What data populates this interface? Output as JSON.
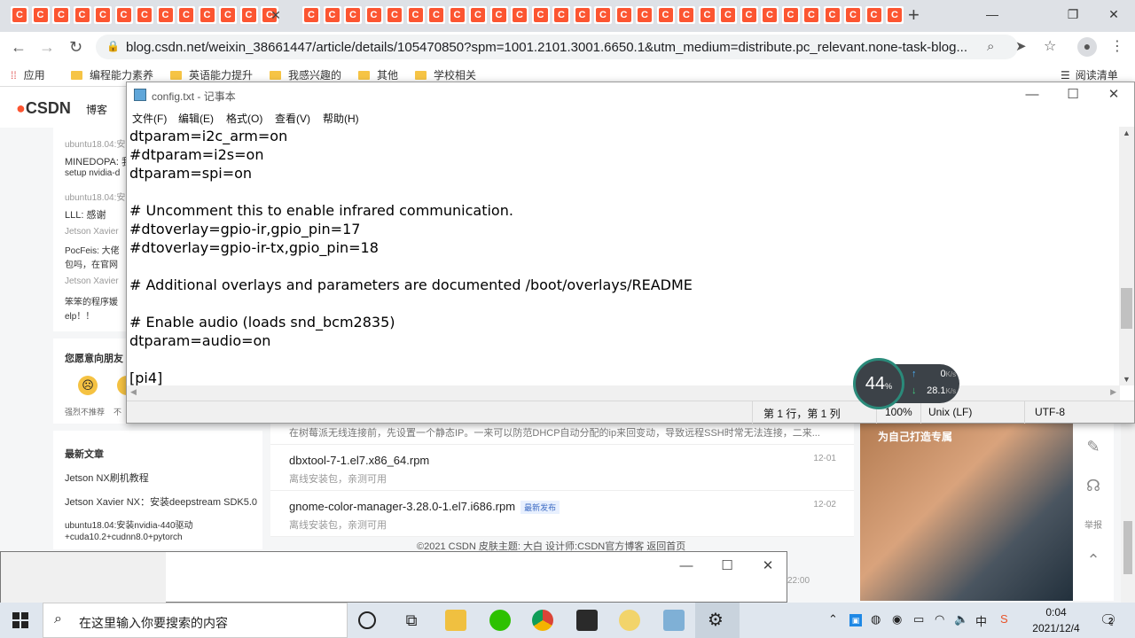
{
  "browser": {
    "tab_icon": "C",
    "url": "blog.csdn.net/weixin_38661447/article/details/105470850?spm=1001.2101.3001.6650.1&utm_medium=distribute.pc_relevant.none-task-blog...",
    "bookmarks": [
      "应用",
      "编程能力素养",
      "英语能力提升",
      "我感兴趣的",
      "其他",
      "学校相关"
    ],
    "reading_list": "阅读清单"
  },
  "page": {
    "logo": "CSDN",
    "nav": [
      "博客"
    ],
    "left_comments": [
      {
        "title": "ubuntu18.04:安",
        "body": "MINEDOPA: 我",
        "body2": "setup nvidia-d"
      },
      {
        "title": "ubuntu18.04:安",
        "body": "LLL: 感谢"
      },
      {
        "title": "Jetson Xavier",
        "body": "PocFeis: 大佬",
        "body2": "包吗，在官网"
      },
      {
        "title": "Jetson Xavier",
        "body": "笨笨的程序媛",
        "body2": "elp！！"
      }
    ],
    "feedback_title": "您愿意向朋友",
    "feedback_labels": [
      "强烈不推荐",
      "不"
    ],
    "recent_title": "最新文章",
    "recent": [
      "Jetson NX刷机教程",
      "Jetson Xavier NX：安装deepstream SDK5.0",
      "ubuntu18.04:安装nvidia-440驱动",
      "+cuda10.2+cudnn8.0+pytorch"
    ],
    "snippet": "在树莓派无线连接前，先设置一个静态IP。一来可以防范DHCP自动分配的ip来回变动，导致远程SSH时常无法连接，二来...",
    "articles": [
      {
        "title": "dbxtool-7-1.el7.x86_64.rpm",
        "sub": "离线安装包，亲测可用",
        "date": "12-01",
        "badge": ""
      },
      {
        "title": "gnome-color-manager-3.28.0-1.el7.i686.rpm",
        "sub": "离线安装包，亲测可用",
        "date": "12-02",
        "badge": "最新发布"
      }
    ],
    "footer": "©2021 CSDN  皮肤主题: 大白  设计师:CSDN官方博客  返回首页",
    "footer_time": "22:00",
    "side_tools": [
      "举报"
    ],
    "ad_caption": "为自己打造专属"
  },
  "notepad": {
    "title": "config.txt - 记事本",
    "menu": [
      "文件(F)",
      "编辑(E)",
      "格式(O)",
      "查看(V)",
      "帮助(H)"
    ],
    "lines": [
      "dtparam=i2c_arm=on",
      "#dtparam=i2s=on",
      "dtparam=spi=on",
      "",
      "# Uncomment this to enable infrared communication.",
      "#dtoverlay=gpio-ir,gpio_pin=17",
      "#dtoverlay=gpio-ir-tx,gpio_pin=18",
      "",
      "# Additional overlays and parameters are documented /boot/overlays/README",
      "",
      "# Enable audio (loads snd_bcm2835)",
      "dtparam=audio=on",
      "",
      "[pi4]"
    ],
    "status": {
      "position": "第 1 行，第 1 列",
      "zoom": "100%",
      "eol": "Unix (LF)",
      "encoding": "UTF-8"
    }
  },
  "netmon": {
    "percent": "44",
    "percent_unit": "%",
    "up": "0",
    "down": "28.1",
    "unit": "K/s"
  },
  "taskbar": {
    "search_placeholder": "在这里输入你要搜索的内容",
    "time": "0:04",
    "date": "2021/12/4",
    "notifications": "2",
    "ime": "中"
  }
}
